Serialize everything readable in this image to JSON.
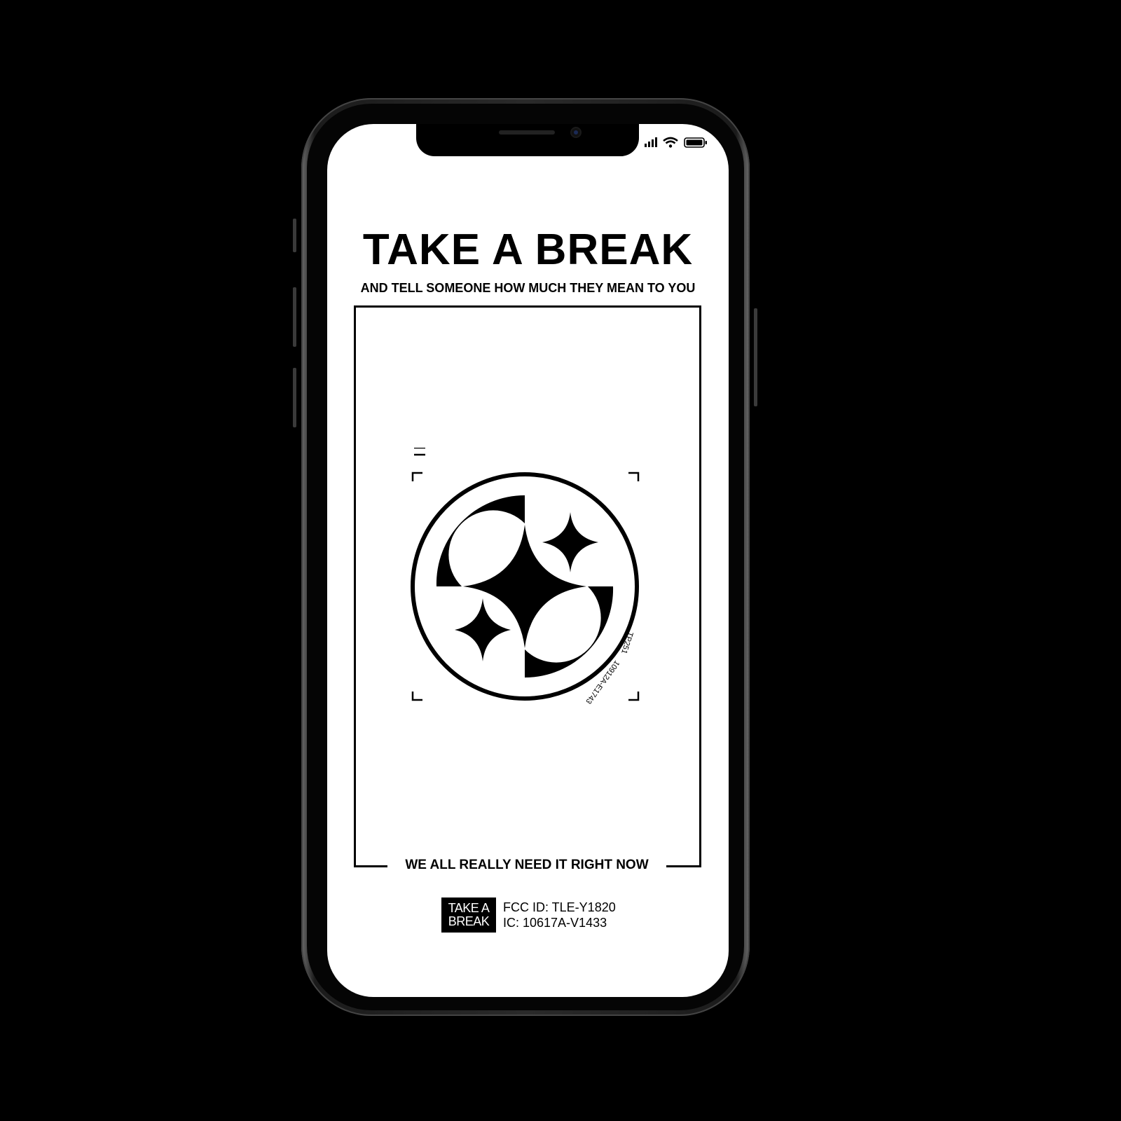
{
  "poster": {
    "title": "TAKE A BREAK",
    "subtitle": "AND TELL SOMEONE HOW MUCH THEY MEAN TO YOU",
    "bottom_line": "WE ALL REALLY NEED IT RIGHT NOW",
    "emblem_code_1": "TP251",
    "emblem_code_2": "10912A-E1743",
    "badge_line_1": "TAKE A",
    "badge_line_2": "BREAK",
    "fcc_id": "FCC ID: TLE-Y1820",
    "ic_id": "IC: 10617A-V1433"
  },
  "status_bar": {
    "signal_icon": "cellular-signal-icon",
    "wifi_icon": "wifi-icon",
    "battery_icon": "battery-icon",
    "battery_level": 1.0
  },
  "colors": {
    "background": "#000000",
    "screen": "#ffffff",
    "ink": "#000000"
  }
}
